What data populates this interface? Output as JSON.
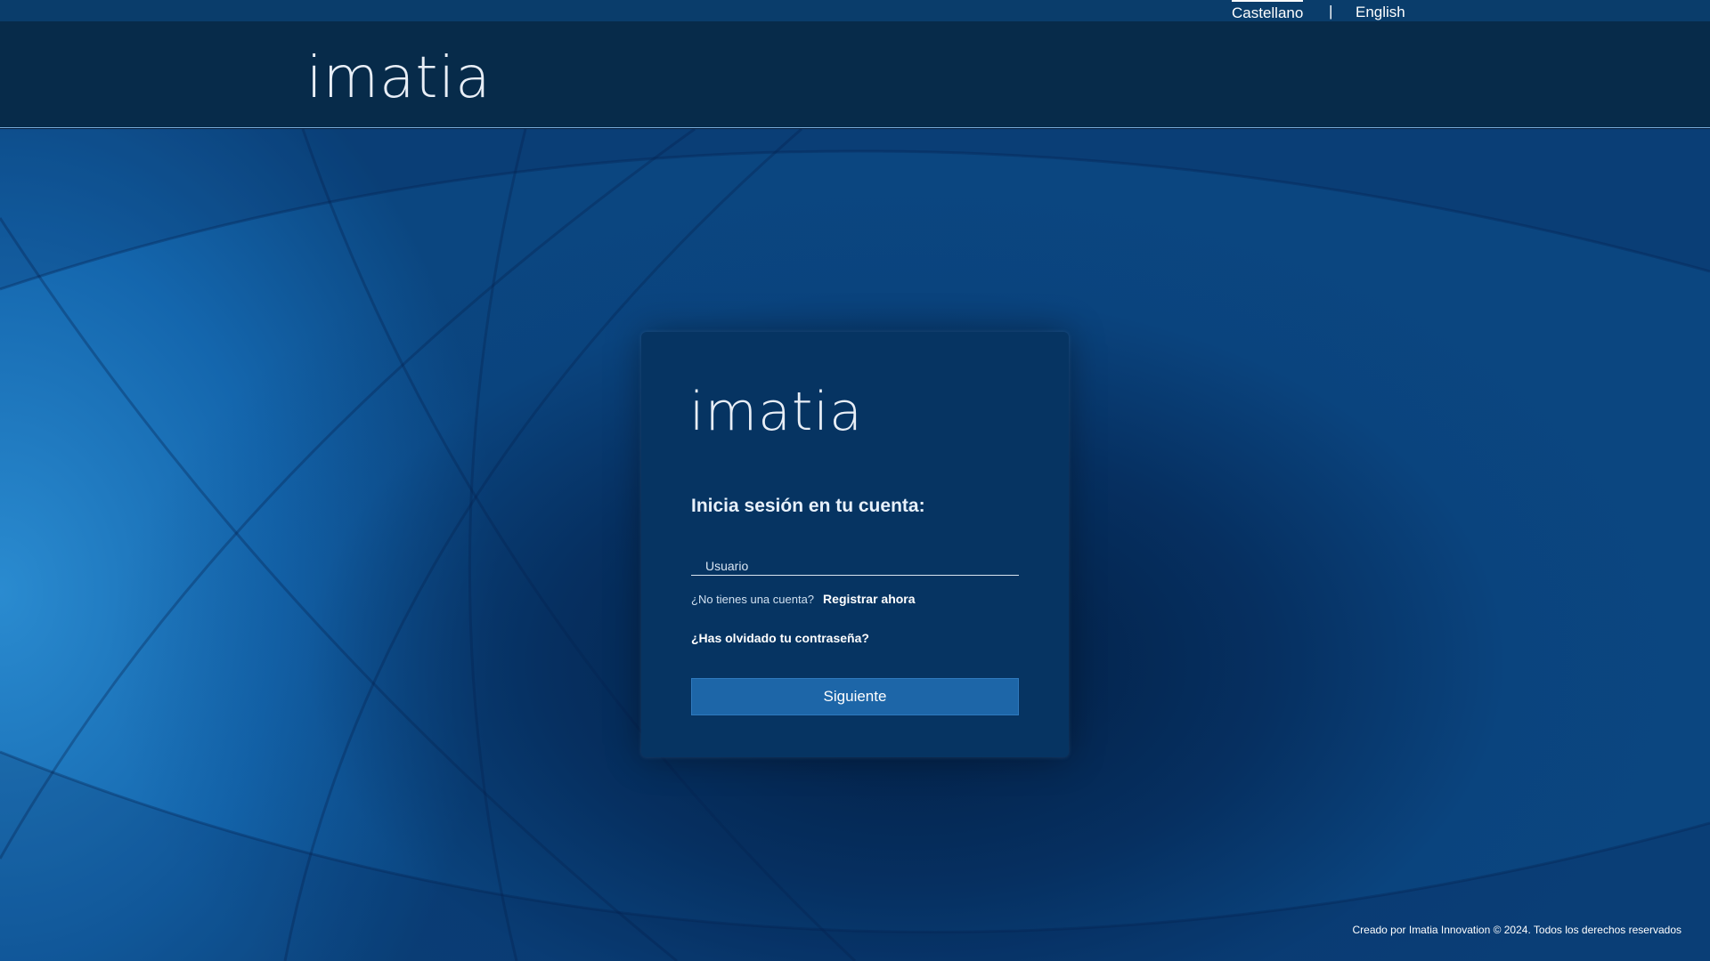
{
  "languages": {
    "castellano": "Castellano",
    "separator": "|",
    "english": "English",
    "active": "Castellano"
  },
  "header": {
    "logo_text": "imatia"
  },
  "login": {
    "logo_text": "imatia",
    "title": "Inicia sesión en tu cuenta:",
    "username_placeholder": "Usuario",
    "username_value": "",
    "no_account_text": "¿No tienes una cuenta?",
    "register_link": "Registrar ahora",
    "forgot_password_link": "¿Has olvidado tu contraseña?",
    "next_button": "Siguiente"
  },
  "footer": {
    "copyright": "Creado por Imatia Innovation © 2024. Todos los derechos reservados"
  },
  "colors": {
    "header_bg": "#072b4a",
    "lang_bar_bg": "#0a3d6b",
    "card_bg": "#063462",
    "button_bg": "#1d66a8"
  }
}
